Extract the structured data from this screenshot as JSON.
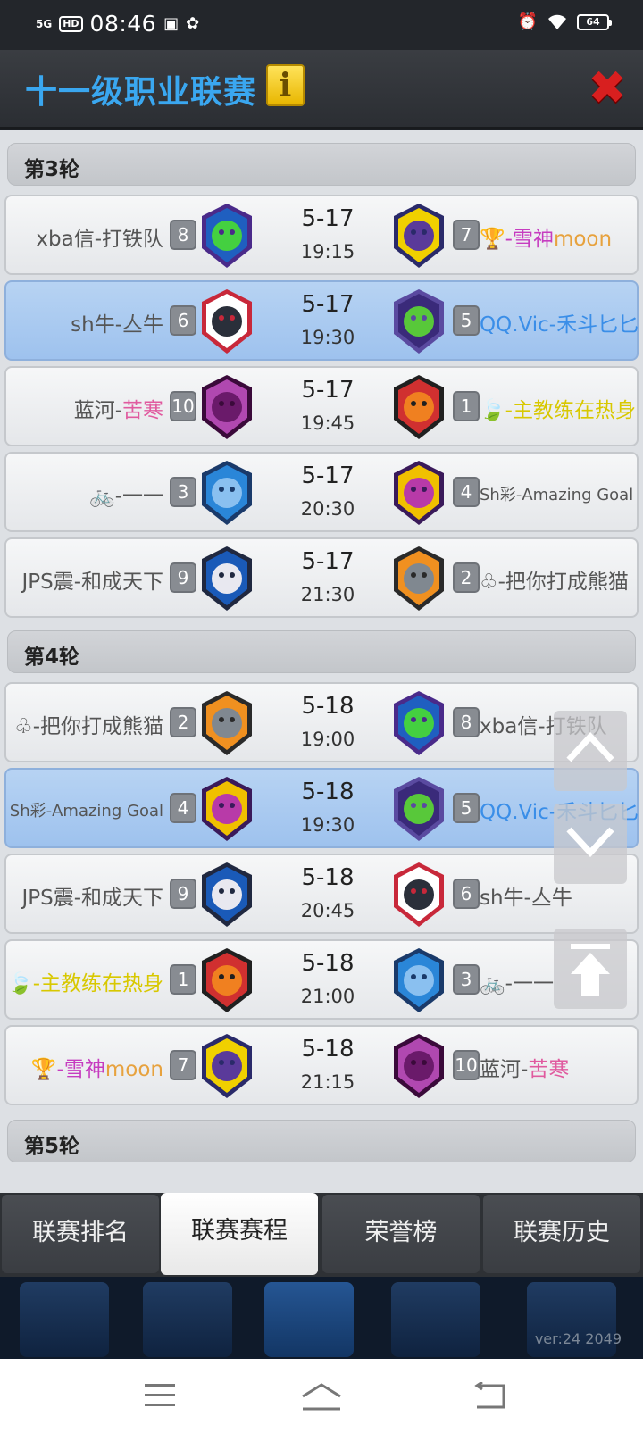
{
  "status_bar": {
    "network": "5G",
    "hd": "HD",
    "time": "08:46",
    "battery": "64"
  },
  "header": {
    "title": "十一级职业联赛",
    "info_label": "i",
    "close_label": "✖"
  },
  "rounds": [
    {
      "label": "第3轮"
    },
    {
      "label": "第4轮"
    },
    {
      "label": "第5轮"
    }
  ],
  "matches": [
    {
      "left": {
        "prefix": "",
        "name_a": "xba信-打铁队",
        "name_b": "",
        "rank": "8",
        "logo": "green-rabbit"
      },
      "right": {
        "prefix": "🏆",
        "name_a": "-雪神",
        "name_b": "moon",
        "rank": "7",
        "logo": "shark"
      },
      "date": "5-17",
      "time": "19:15",
      "highlight": false
    },
    {
      "left": {
        "prefix": "",
        "name_a": "sh牛-亼牛",
        "name_b": "",
        "rank": "6",
        "logo": "bull"
      },
      "right": {
        "prefix": "",
        "name_a": "QQ.Vic-禾斗匕匕",
        "name_b": "",
        "rank": "5",
        "logo": "griffin"
      },
      "date": "5-17",
      "time": "19:30",
      "highlight": true
    },
    {
      "left": {
        "prefix": "",
        "name_a": "蓝河-",
        "name_b": "苦寒",
        "rank": "10",
        "logo": "purple-ball"
      },
      "right": {
        "prefix": "🍃",
        "name_a": "-主教练在热身",
        "name_b": "",
        "rank": "1",
        "logo": "tiger"
      },
      "date": "5-17",
      "time": "19:45",
      "highlight": false
    },
    {
      "left": {
        "prefix": "🚲",
        "name_a": "-一一",
        "name_b": "",
        "rank": "3",
        "logo": "blue-rabbit"
      },
      "right": {
        "prefix": "",
        "name_a": "Sh彩-Amazing Goal",
        "name_b": "",
        "rank": "4",
        "logo": "dragon"
      },
      "date": "5-17",
      "time": "20:30",
      "highlight": false
    },
    {
      "left": {
        "prefix": "",
        "name_a": "JPS震-和成天下",
        "name_b": "",
        "rank": "9",
        "logo": "wizard"
      },
      "right": {
        "prefix": "♧",
        "name_a": "-把你打成熊猫",
        "name_b": "",
        "rank": "2",
        "logo": "knight"
      },
      "date": "5-17",
      "time": "21:30",
      "highlight": false
    },
    {
      "left": {
        "prefix": "♧",
        "name_a": "-把你打成熊猫",
        "name_b": "",
        "rank": "2",
        "logo": "knight"
      },
      "right": {
        "prefix": "",
        "name_a": "xba信-打铁队",
        "name_b": "",
        "rank": "8",
        "logo": "green-rabbit"
      },
      "date": "5-18",
      "time": "19:00",
      "highlight": false
    },
    {
      "left": {
        "prefix": "",
        "name_a": "Sh彩-Amazing Goal",
        "name_b": "",
        "rank": "4",
        "logo": "dragon"
      },
      "right": {
        "prefix": "",
        "name_a": "QQ.Vic-禾斗匕匕",
        "name_b": "",
        "rank": "5",
        "logo": "griffin"
      },
      "date": "5-18",
      "time": "19:30",
      "highlight": true
    },
    {
      "left": {
        "prefix": "",
        "name_a": "JPS震-和成天下",
        "name_b": "",
        "rank": "9",
        "logo": "wizard"
      },
      "right": {
        "prefix": "",
        "name_a": "sh牛-亼牛",
        "name_b": "",
        "rank": "6",
        "logo": "bull"
      },
      "date": "5-18",
      "time": "20:45",
      "highlight": false
    },
    {
      "left": {
        "prefix": "🍃",
        "name_a": "-主教练在热身",
        "name_b": "",
        "rank": "1",
        "logo": "tiger"
      },
      "right": {
        "prefix": "🚲",
        "name_a": "-一一",
        "name_b": "",
        "rank": "3",
        "logo": "blue-rabbit"
      },
      "date": "5-18",
      "time": "21:00",
      "highlight": false
    },
    {
      "left": {
        "prefix": "🏆",
        "name_a": "-雪神",
        "name_b": "moon",
        "rank": "7",
        "logo": "shark"
      },
      "right": {
        "prefix": "",
        "name_a": "蓝河-",
        "name_b": "苦寒",
        "rank": "10",
        "logo": "purple-ball"
      },
      "date": "5-18",
      "time": "21:15",
      "highlight": false
    }
  ],
  "tabs": [
    {
      "label": "联赛排名",
      "active": false
    },
    {
      "label": "联赛赛程",
      "active": true
    },
    {
      "label": "荣誉榜",
      "active": false
    },
    {
      "label": "联赛历史",
      "active": false
    }
  ],
  "footer": {
    "version": "ver:24  2049"
  },
  "colors": {
    "title": "#3aa7f0",
    "highlight_row": "#a8c8f0",
    "close": "#d81f1f",
    "info": "#f2c200"
  }
}
